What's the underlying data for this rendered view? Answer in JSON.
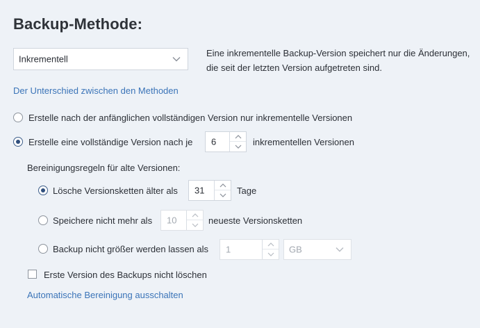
{
  "section": {
    "title": "Backup-Methode:"
  },
  "method": {
    "selected": "Inkrementell",
    "description": "Eine inkrementelle Backup-Version speichert nur die Änderungen, die seit der letzten Version aufgetreten sind.",
    "difference_link": "Der Unterschied zwischen den Methoden"
  },
  "versions": {
    "option_incremental_only": "Erstelle nach der anfänglichen vollständigen Version nur inkrementelle Versionen",
    "option_full_every_prefix": "Erstelle eine vollständige Version nach je",
    "full_every_value": "6",
    "option_full_every_suffix": "inkrementellen Versionen",
    "selected_option": "full_every"
  },
  "cleanup": {
    "heading": "Bereinigungsregeln für alte Versionen:",
    "delete_older_prefix": "Lösche Versionsketten älter als",
    "delete_older_value": "31",
    "delete_older_suffix": "Tage",
    "keep_max_prefix": "Speichere nicht mehr als",
    "keep_max_value": "10",
    "keep_max_suffix": "neueste Versionsketten",
    "size_limit_prefix": "Backup nicht größer werden lassen als",
    "size_limit_value": "1",
    "size_unit": "GB",
    "selected_rule": "delete_older",
    "keep_first_label": "Erste Version des Backups nicht löschen",
    "keep_first_checked": false,
    "disable_auto_cleanup_link": "Automatische Bereinigung ausschalten"
  },
  "colors": {
    "background": "#eef2f7",
    "link": "#3b74b8",
    "radio_selected": "#2f4f7d"
  }
}
